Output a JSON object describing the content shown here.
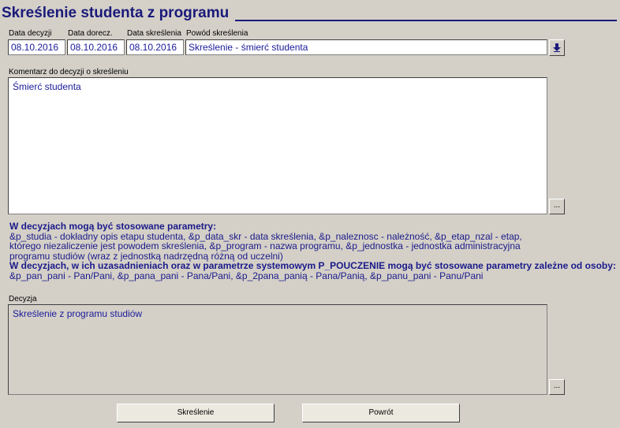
{
  "title": "Skreślenie studenta z programu",
  "labels": {
    "data_decyzji": "Data decyzji",
    "data_doreczenia": "Data dorecz.",
    "data_skreslenia": "Data skreślenia",
    "powod": "Powód skreślenia",
    "komentarz": "Komentarz do decyzji o skreśleniu",
    "decyzja": "Decyzja"
  },
  "fields": {
    "data_decyzji": "08.10.2016",
    "data_doreczenia": "08.10.2016",
    "data_skreslenia": "08.10.2016",
    "powod": "Skreślenie - śmierć studenta",
    "komentarz": "Śmierć studenta",
    "decyzja": "Skreślenie z programu studiów"
  },
  "info": {
    "heading1": "W decyzjach mogą być stosowane parametry:",
    "line1": "&p_studia - dokładny opis etapu studenta, &p_data_skr - data skreślenia, &p_naleznosc - należność, &p_etap_nzal - etap,",
    "line2": "którego niezaliczenie jest powodem skreślenia, &p_program - nazwa programu, &p_jednostka - jednostka administracyjna",
    "line3": "programu studiów (wraz z jednostką nadrzędną różną od uczelni)",
    "heading2": "W decyzjach, w ich uzasadnieniach oraz w parametrze systemowym P_POUCZENIE mogą być stosowane parametry zależne od osoby:",
    "line4": "&p_pan_pani - Pan/Pani, &p_pana_pani - Pana/Pani, &p_2pana_panią - Pana/Panią, &p_panu_pani - Panu/Pani"
  },
  "buttons": {
    "dots": "...",
    "skreslenie": "Skreślenie",
    "powrot": "Powrót"
  },
  "icons": {
    "dropdown": "arrow-down-icon"
  }
}
